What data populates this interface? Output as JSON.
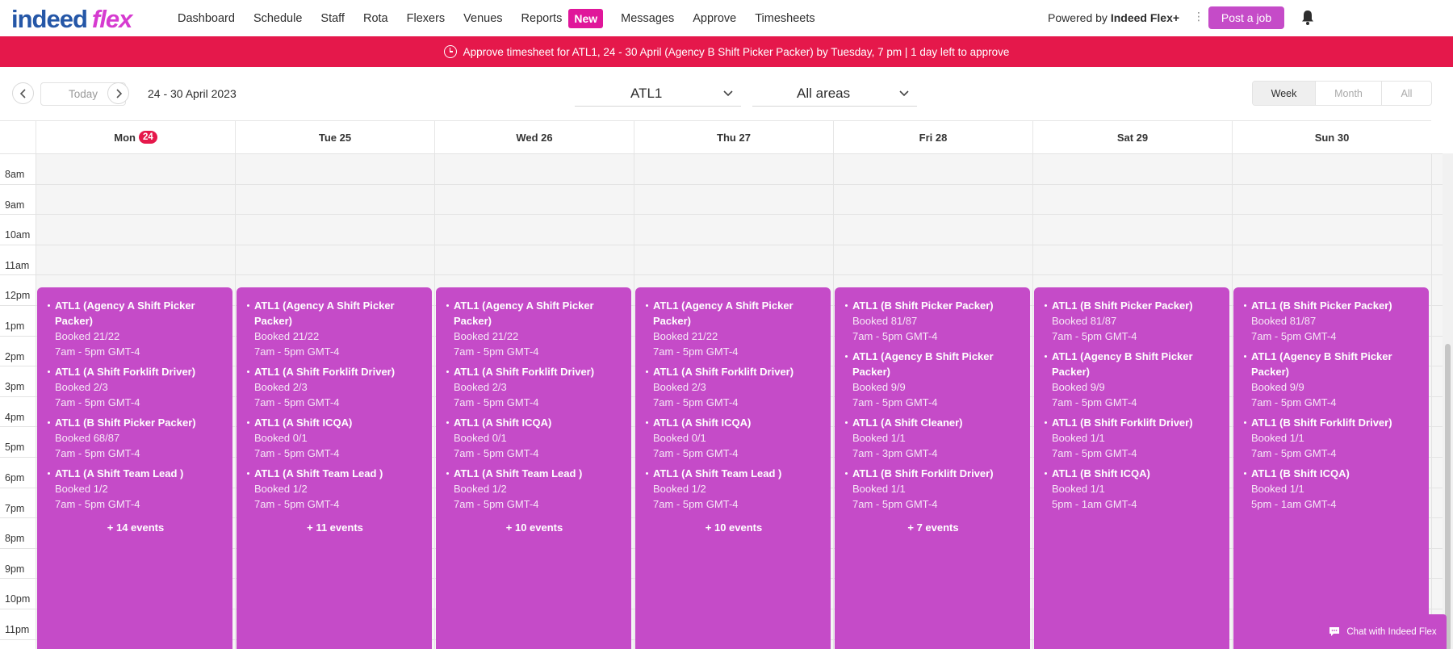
{
  "logo": {
    "word1": "indeed",
    "word2": "flex"
  },
  "nav": {
    "items": [
      "Dashboard",
      "Schedule",
      "Staff",
      "Rota",
      "Flexers",
      "Venues",
      "Reports"
    ],
    "new_badge": "New",
    "items2": [
      "Messages",
      "Approve",
      "Timesheets"
    ],
    "powered_prefix": "Powered by",
    "powered_brand": "Indeed Flex+",
    "post_job": "Post a job",
    "icons": {
      "bell": "bell-icon",
      "kebab": "kebab-icon"
    }
  },
  "banner": {
    "text": "Approve timesheet for ATL1, 24 - 30 April (Agency B Shift Picker Packer) by Tuesday, 7 pm | 1 day left to approve",
    "color": "#e5184b",
    "icon": "clock-icon"
  },
  "toolbar": {
    "today": "Today",
    "date_range": "24 - 30 April 2023",
    "venue": "ATL1",
    "area": "All areas",
    "views": [
      "Week",
      "Month",
      "All"
    ],
    "active_view": "Week"
  },
  "calendar": {
    "days": [
      {
        "label": "Mon",
        "num": "24",
        "today": true
      },
      {
        "label": "Tue 25"
      },
      {
        "label": "Wed 26"
      },
      {
        "label": "Thu 27"
      },
      {
        "label": "Fri 28"
      },
      {
        "label": "Sat 29"
      },
      {
        "label": "Sun 30"
      }
    ],
    "hours": [
      "8am",
      "9am",
      "10am",
      "11am",
      "12pm",
      "1pm",
      "2pm",
      "3pm",
      "4pm",
      "5pm",
      "6pm",
      "7pm",
      "8pm",
      "9pm",
      "10pm",
      "11pm"
    ],
    "columns": [
      {
        "events": [
          {
            "title": "ATL1 (Agency A Shift Picker Packer)",
            "booked": "Booked 21/22",
            "time": "7am - 5pm GMT-4"
          },
          {
            "title": "ATL1 (A Shift Forklift Driver)",
            "booked": "Booked 2/3",
            "time": "7am - 5pm GMT-4"
          },
          {
            "title": "ATL1 (B Shift Picker Packer)",
            "booked": "Booked 68/87",
            "time": "7am - 5pm GMT-4"
          },
          {
            "title": "ATL1 (A Shift Team Lead )",
            "booked": "Booked 1/2",
            "time": "7am - 5pm GMT-4"
          }
        ],
        "more": "+ 14 events"
      },
      {
        "events": [
          {
            "title": "ATL1 (Agency A Shift Picker Packer)",
            "booked": "Booked 21/22",
            "time": "7am - 5pm GMT-4"
          },
          {
            "title": "ATL1 (A Shift Forklift Driver)",
            "booked": "Booked 2/3",
            "time": "7am - 5pm GMT-4"
          },
          {
            "title": "ATL1 (A Shift ICQA)",
            "booked": "Booked 0/1",
            "time": "7am - 5pm GMT-4"
          },
          {
            "title": "ATL1 (A Shift Team Lead )",
            "booked": "Booked 1/2",
            "time": "7am - 5pm GMT-4"
          }
        ],
        "more": "+ 11 events"
      },
      {
        "events": [
          {
            "title": "ATL1 (Agency A Shift Picker Packer)",
            "booked": "Booked 21/22",
            "time": "7am - 5pm GMT-4"
          },
          {
            "title": "ATL1 (A Shift Forklift Driver)",
            "booked": "Booked 2/3",
            "time": "7am - 5pm GMT-4"
          },
          {
            "title": "ATL1 (A Shift ICQA)",
            "booked": "Booked 0/1",
            "time": "7am - 5pm GMT-4"
          },
          {
            "title": "ATL1 (A Shift Team Lead )",
            "booked": "Booked 1/2",
            "time": "7am - 5pm GMT-4"
          }
        ],
        "more": "+ 10 events"
      },
      {
        "events": [
          {
            "title": "ATL1 (Agency A Shift Picker Packer)",
            "booked": "Booked 21/22",
            "time": "7am - 5pm GMT-4"
          },
          {
            "title": "ATL1 (A Shift Forklift Driver)",
            "booked": "Booked 2/3",
            "time": "7am - 5pm GMT-4"
          },
          {
            "title": "ATL1 (A Shift ICQA)",
            "booked": "Booked 0/1",
            "time": "7am - 5pm GMT-4"
          },
          {
            "title": "ATL1 (A Shift Team Lead )",
            "booked": "Booked 1/2",
            "time": "7am - 5pm GMT-4"
          }
        ],
        "more": "+ 10 events"
      },
      {
        "events": [
          {
            "title": "ATL1 (B Shift Picker Packer)",
            "booked": "Booked 81/87",
            "time": "7am - 5pm GMT-4"
          },
          {
            "title": "ATL1 (Agency B Shift Picker Packer)",
            "booked": "Booked 9/9",
            "time": "7am - 5pm GMT-4"
          },
          {
            "title": "ATL1 (A Shift Cleaner)",
            "booked": "Booked 1/1",
            "time": "7am - 3pm GMT-4"
          },
          {
            "title": "ATL1 (B Shift Forklift Driver)",
            "booked": "Booked 1/1",
            "time": "7am - 5pm GMT-4"
          }
        ],
        "more": "+ 7 events"
      },
      {
        "events": [
          {
            "title": "ATL1 (B Shift Picker Packer)",
            "booked": "Booked 81/87",
            "time": "7am - 5pm GMT-4"
          },
          {
            "title": "ATL1 (Agency B Shift Picker Packer)",
            "booked": "Booked 9/9",
            "time": "7am - 5pm GMT-4"
          },
          {
            "title": "ATL1 (B Shift Forklift Driver)",
            "booked": "Booked 1/1",
            "time": "7am - 5pm GMT-4"
          },
          {
            "title": "ATL1 (B Shift ICQA)",
            "booked": "Booked 1/1",
            "time": "5pm - 1am GMT-4"
          }
        ],
        "more": ""
      },
      {
        "events": [
          {
            "title": "ATL1 (B Shift Picker Packer)",
            "booked": "Booked 81/87",
            "time": "7am - 5pm GMT-4"
          },
          {
            "title": "ATL1 (Agency B Shift Picker Packer)",
            "booked": "Booked 9/9",
            "time": "7am - 5pm GMT-4"
          },
          {
            "title": "ATL1 (B Shift Forklift Driver)",
            "booked": "Booked 1/1",
            "time": "7am - 5pm GMT-4"
          },
          {
            "title": "ATL1 (B Shift ICQA)",
            "booked": "Booked 1/1",
            "time": "5pm - 1am GMT-4"
          }
        ],
        "more": ""
      }
    ]
  },
  "chat": {
    "label": "Chat with Indeed Flex",
    "icon": "chat-icon"
  },
  "colors": {
    "accent": "#c54bc8",
    "alert": "#e5184b",
    "brand_blue": "#2557a7",
    "new_badge": "#e0169a"
  }
}
